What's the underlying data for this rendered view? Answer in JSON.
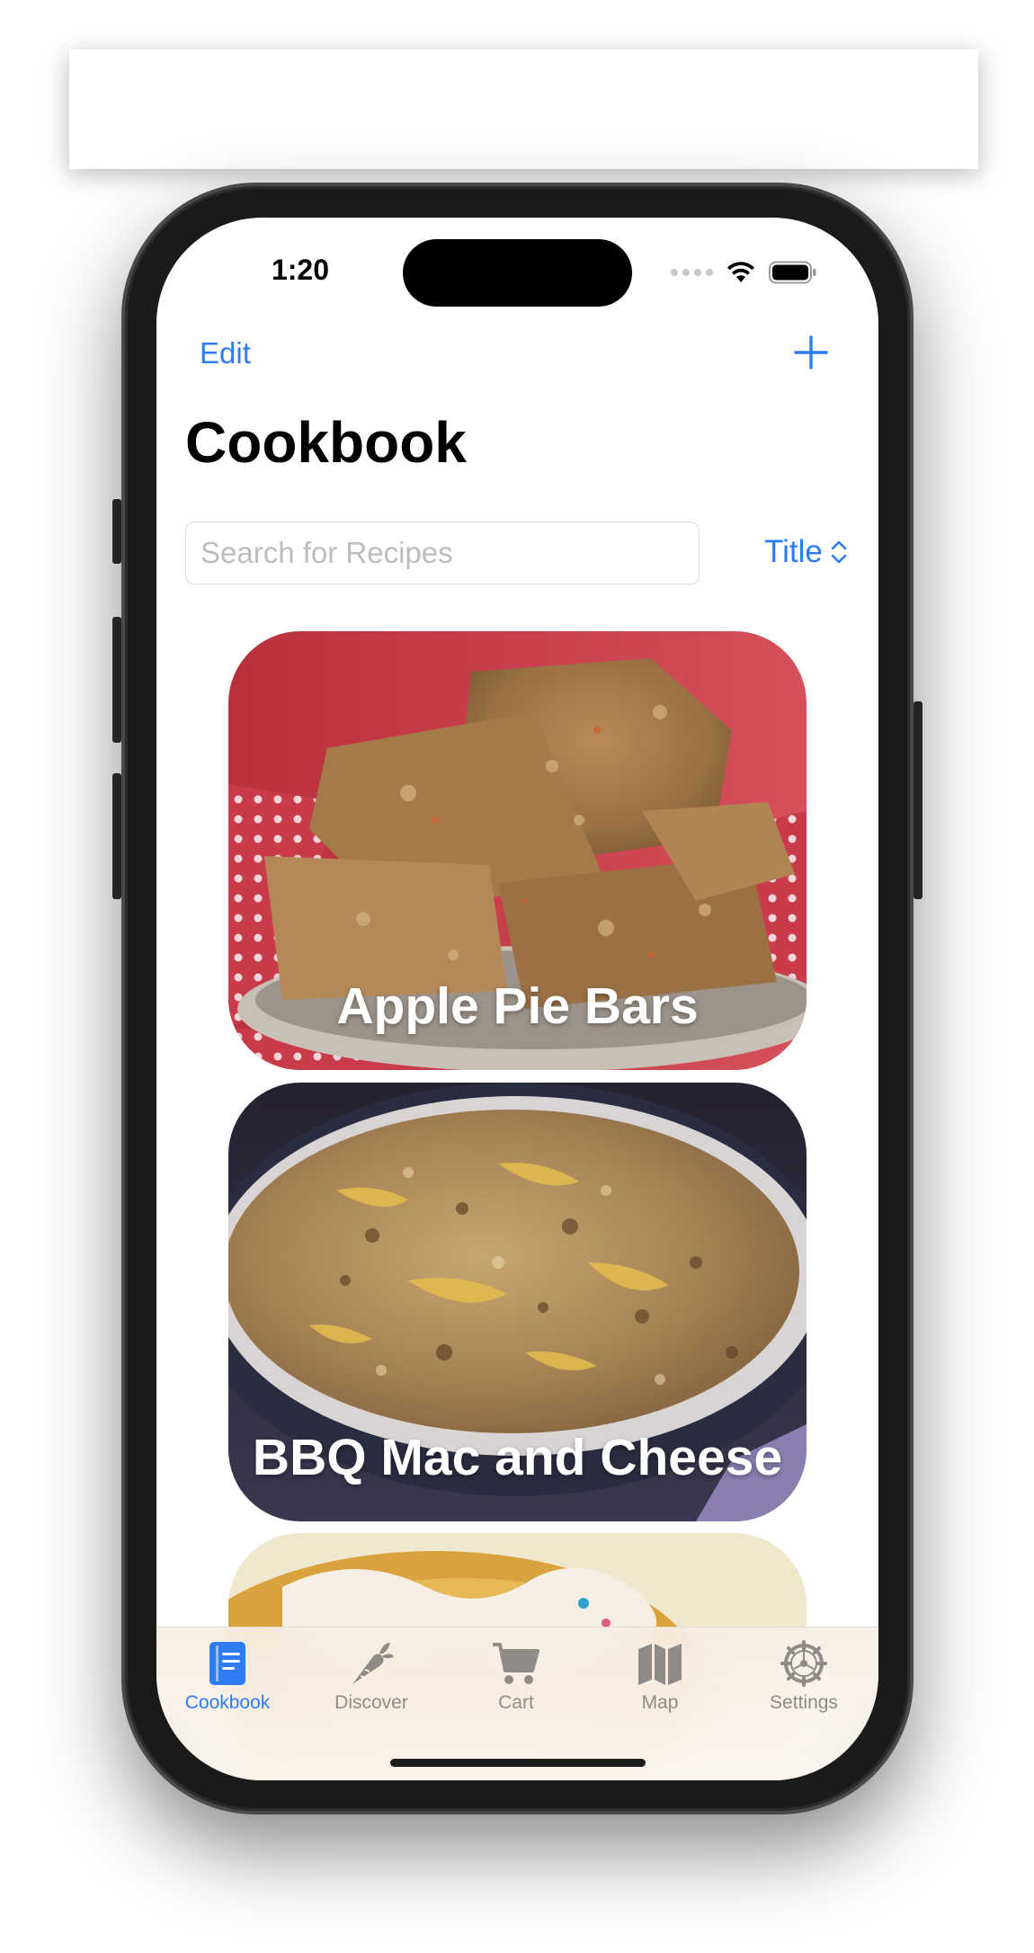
{
  "status_bar": {
    "time": "1:20",
    "icons": [
      "cellular-dots-icon",
      "wifi-icon",
      "battery-icon"
    ]
  },
  "nav": {
    "edit_label": "Edit",
    "add_icon": "plus-icon"
  },
  "page": {
    "title": "Cookbook"
  },
  "search": {
    "placeholder": "Search for Recipes",
    "value": ""
  },
  "sort": {
    "label": "Title",
    "icon": "chevron-up-down-icon"
  },
  "recipes": [
    {
      "title": "Apple Pie Bars"
    },
    {
      "title": "BBQ Mac and Cheese"
    },
    {
      "title": ""
    }
  ],
  "tab_bar": {
    "tabs": [
      {
        "label": "Cookbook",
        "icon": "book-icon",
        "active": true
      },
      {
        "label": "Discover",
        "icon": "carrot-icon",
        "active": false
      },
      {
        "label": "Cart",
        "icon": "cart-icon",
        "active": false
      },
      {
        "label": "Map",
        "icon": "map-icon",
        "active": false
      },
      {
        "label": "Settings",
        "icon": "gear-icon",
        "active": false
      }
    ]
  },
  "colors": {
    "accent": "#2d7cf6",
    "tab_inactive": "#8e8b88",
    "title": "#000000"
  }
}
